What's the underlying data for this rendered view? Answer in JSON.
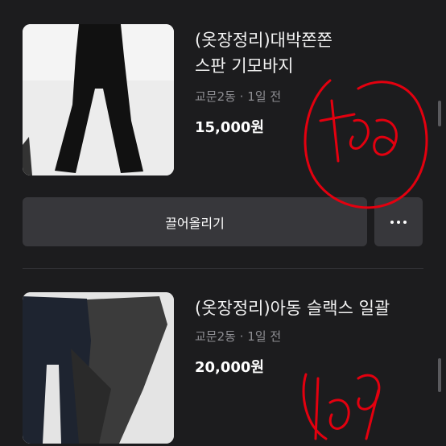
{
  "listings": [
    {
      "title": "(옷장정리)대박쫀쫀\n스판 기모바지",
      "location": "교문2동",
      "time": "1일 전",
      "price": "15,000원"
    },
    {
      "title": "(옷장정리)아동 슬랙스 일괄",
      "location": "교문2동",
      "time": "1일 전",
      "price": "20,000원"
    }
  ],
  "actions": {
    "bump_label": "끌어올리기",
    "more_icon": "more-horizontal-icon"
  },
  "meta_separator": "·",
  "colors": {
    "background": "#1c1c1e",
    "button": "#37373b",
    "meta_text": "#8e8e93",
    "annotation": "#e3000f"
  }
}
